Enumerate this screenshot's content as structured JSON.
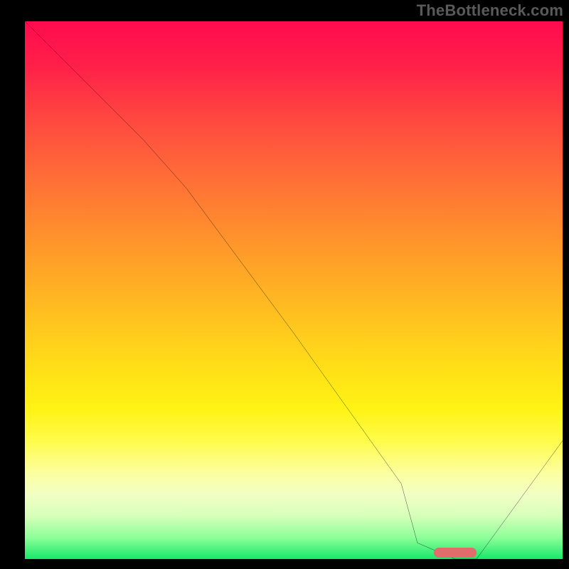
{
  "attribution": "TheBottleneck.com",
  "colors": {
    "frame": "#000000",
    "attribution_text": "#5a5a5a",
    "curve": "#000000",
    "marker": "#e26b6b",
    "gradient_stops": [
      "#ff0b4e",
      "#ff1f49",
      "#ff4740",
      "#ff6a38",
      "#ff8b2e",
      "#ffab25",
      "#ffcb1d",
      "#ffe316",
      "#fff314",
      "#fffb4a",
      "#fcffa0",
      "#f2ffc4",
      "#d6ffba",
      "#8dff99",
      "#17e86a"
    ]
  },
  "chart_data": {
    "type": "line",
    "title": "",
    "xlabel": "",
    "ylabel": "",
    "xlim": [
      0,
      100
    ],
    "ylim": [
      0,
      100
    ],
    "grid": false,
    "legend": false,
    "series": [
      {
        "name": "bottleneck-curve",
        "x": [
          0,
          6,
          22,
          30,
          50,
          70,
          73,
          80,
          84,
          100
        ],
        "values": [
          100,
          94,
          78,
          69,
          42,
          14,
          3,
          0,
          0,
          22
        ]
      }
    ],
    "annotations": [
      {
        "name": "optimal-range-marker",
        "type": "hspan",
        "x0": 76,
        "x1": 84,
        "y": 0
      }
    ]
  }
}
